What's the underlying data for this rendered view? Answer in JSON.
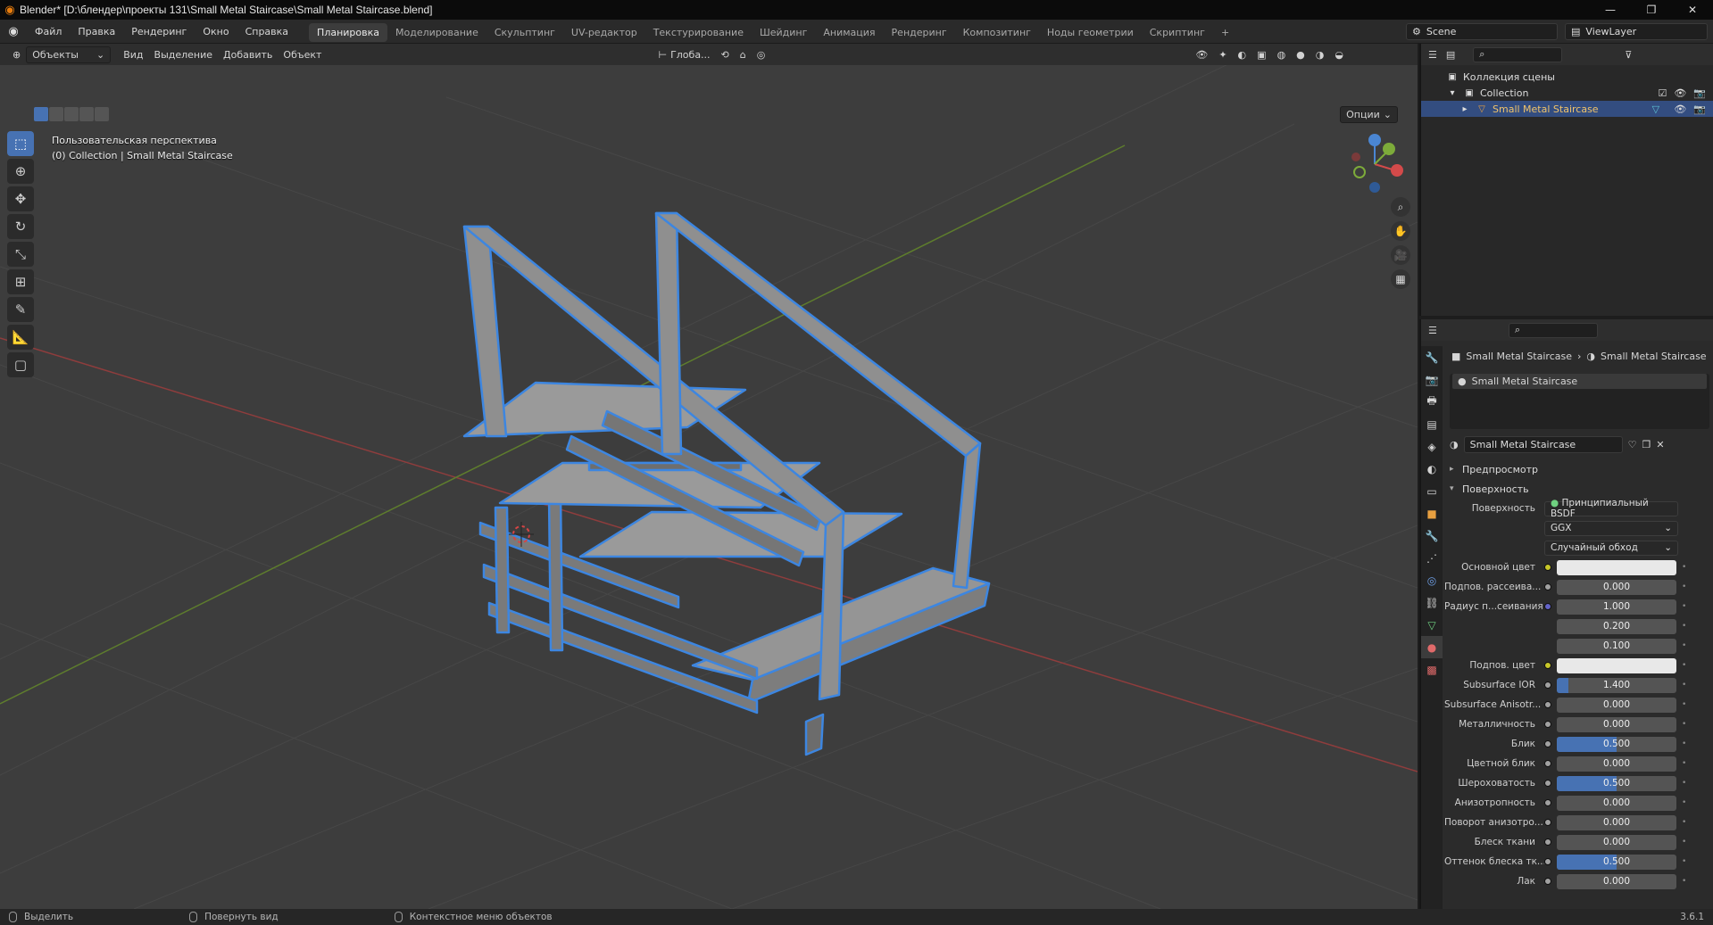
{
  "window": {
    "title": "Blender* [D:\\блендер\\проекты 131\\Small Metal Staircase\\Small Metal Staircase.blend]",
    "controls": [
      "—",
      "❐",
      "✕"
    ]
  },
  "menu": {
    "items": [
      "Файл",
      "Правка",
      "Рендеринг",
      "Окно",
      "Справка"
    ],
    "workspaces": [
      "Планировка",
      "Моделирование",
      "Скульптинг",
      "UV-редактор",
      "Текстурирование",
      "Шейдинг",
      "Анимация",
      "Рендеринг",
      "Композитинг",
      "Ноды геометрии",
      "Скриптинг",
      "+"
    ],
    "active_workspace": "Планировка",
    "scene": "Scene",
    "view_layer": "ViewLayer"
  },
  "viewport": {
    "mode": "Объекты",
    "menus": [
      "Вид",
      "Выделение",
      "Добавить",
      "Объект"
    ],
    "orientation": "Глоба...",
    "options": "Опции",
    "perspective_label": "Пользовательская перспектива",
    "collection_label": "(0) Collection | Small Metal Staircase",
    "tools": [
      "select",
      "cursor",
      "move",
      "rotate",
      "scale",
      "transform",
      "annotate",
      "measure",
      "add-cube"
    ],
    "gizmo_axes": {
      "x": "X",
      "y": "Y",
      "z": "Z"
    }
  },
  "outliner": {
    "rows": [
      {
        "label": "Коллекция сцены",
        "level": 0
      },
      {
        "label": "Collection",
        "level": 1
      },
      {
        "label": "Small Metal Staircase",
        "level": 2,
        "selected": true
      }
    ]
  },
  "properties": {
    "breadcrumb": [
      "Small Metal Staircase",
      "Small Metal Staircase"
    ],
    "slot_name": "Small Metal Staircase",
    "material_name": "Small Metal Staircase",
    "sections": {
      "preview": "Предпросмотр",
      "surface": "Поверхность"
    },
    "surface_label": "Поверхность",
    "surface_value": "Принципиальный BSDF",
    "distribution": "GGX",
    "subsurface_method": "Случайный обход",
    "fields": [
      {
        "label": "Основной цвет",
        "value": "",
        "kind": "color",
        "dot": "yellow"
      },
      {
        "label": "Подпов. рассеива...",
        "value": "0.000",
        "kind": "num",
        "dot": "gray",
        "fill": 0
      },
      {
        "label": "Радиус п...сеивания",
        "value": "1.000",
        "kind": "num",
        "dot": "purple",
        "fill": 0
      },
      {
        "label": "",
        "value": "0.200",
        "kind": "num",
        "fill": 0
      },
      {
        "label": "",
        "value": "0.100",
        "kind": "num",
        "fill": 0
      },
      {
        "label": "Подпов. цвет",
        "value": "",
        "kind": "color",
        "dot": "yellow"
      },
      {
        "label": "Subsurface IOR",
        "value": "1.400",
        "kind": "num",
        "dot": "gray",
        "fill": 0.1
      },
      {
        "label": "Subsurface Anisotr...",
        "value": "0.000",
        "kind": "num",
        "dot": "gray",
        "fill": 0
      },
      {
        "label": "Металличность",
        "value": "0.000",
        "kind": "num",
        "dot": "gray",
        "fill": 0
      },
      {
        "label": "Блик",
        "value": "0.500",
        "kind": "num",
        "dot": "gray",
        "fill": 0.5
      },
      {
        "label": "Цветной блик",
        "value": "0.000",
        "kind": "num",
        "dot": "gray",
        "fill": 0
      },
      {
        "label": "Шероховатость",
        "value": "0.500",
        "kind": "num",
        "dot": "gray",
        "fill": 0.5
      },
      {
        "label": "Анизотропность",
        "value": "0.000",
        "kind": "num",
        "dot": "gray",
        "fill": 0
      },
      {
        "label": "Поворот анизотро...",
        "value": "0.000",
        "kind": "num",
        "dot": "gray",
        "fill": 0
      },
      {
        "label": "Блеск ткани",
        "value": "0.000",
        "kind": "num",
        "dot": "gray",
        "fill": 0
      },
      {
        "label": "Оттенок блеска тк...",
        "value": "0.500",
        "kind": "num",
        "dot": "gray",
        "fill": 0.5
      },
      {
        "label": "Лак",
        "value": "0.000",
        "kind": "num",
        "dot": "gray",
        "fill": 0
      }
    ]
  },
  "status": {
    "items": [
      "Выделить",
      "Повернуть вид",
      "Контекстное меню объектов"
    ],
    "version": "3.6.1"
  },
  "colors": {
    "accent": "#4772b3",
    "selection_outline": "#3d86e0",
    "axis_x": "#d34a4a",
    "axis_y": "#7dab3a",
    "axis_z": "#4a86d3"
  }
}
